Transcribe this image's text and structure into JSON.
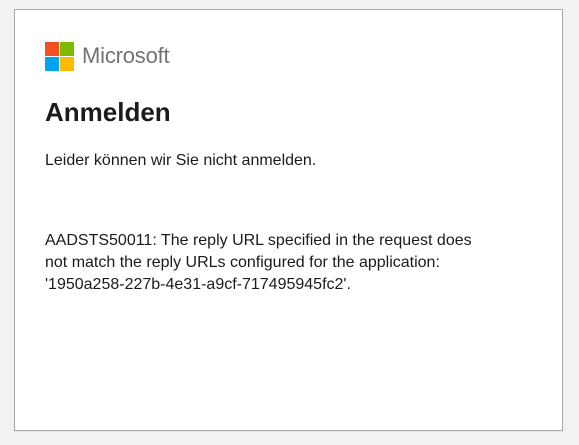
{
  "brand": {
    "name": "Microsoft",
    "logo_colors": [
      "#f25022",
      "#7fba00",
      "#00a4ef",
      "#ffb900"
    ]
  },
  "title": "Anmelden",
  "message": "Leider können wir Sie nicht anmelden.",
  "error_lines": [
    "AADSTS50011: The reply URL specified in the request does",
    "not match the reply URLs configured for the application:",
    "'1950a258-227b-4e31-a9cf-717495945fc2'."
  ]
}
